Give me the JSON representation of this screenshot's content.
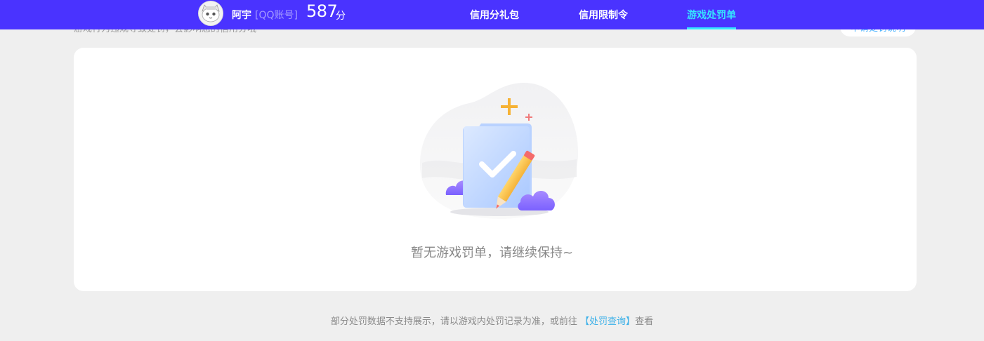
{
  "header": {
    "user_name": "阿宇",
    "account_type": "[QQ账号]",
    "score": "587",
    "score_unit": "分",
    "tabs": [
      {
        "label": "信用分礼包",
        "active": false
      },
      {
        "label": "信用限制令",
        "active": false
      },
      {
        "label": "游戏处罚单",
        "active": true
      }
    ]
  },
  "subheader": {
    "description": "游戏行为违规导致处罚，会影响您的信用分哦",
    "link": "申请处罚说明"
  },
  "empty_state": {
    "icon": "empty-checklist-illustration",
    "message": "暂无游戏罚单，请继续保持~"
  },
  "footer": {
    "prefix": "部分处罚数据不支持展示，请以游戏内处罚记录为准，或前往 ",
    "link": "【处罚查询】",
    "suffix": "查看"
  },
  "colors": {
    "nav_bg": "#4a33ff",
    "active_tab": "#35e6ff",
    "link": "#3bb0e8"
  }
}
